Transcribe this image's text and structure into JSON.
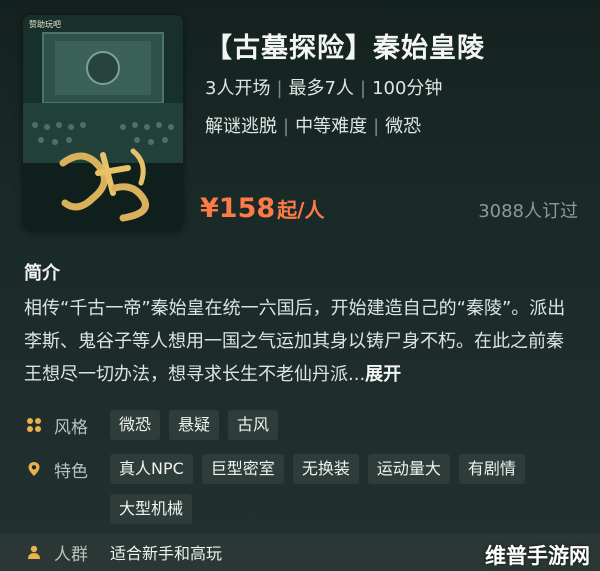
{
  "poster": {
    "brand": "赞助玩吧",
    "calligraphy": "秦始皇陵",
    "icon": "game-poster-image"
  },
  "title": "【古墓探险】秦始皇陵",
  "meta": {
    "players_start": "3人开场",
    "players_max": "最多7人",
    "duration": "100分钟",
    "genre": "解谜逃脱",
    "difficulty": "中等难度",
    "horror_level": "微恐"
  },
  "price": {
    "amount": "¥158",
    "unit": "起/人",
    "color": "#ff7a45"
  },
  "booked_count": "3088人订过",
  "intro": {
    "heading": "简介",
    "text": "相传“千古一帝”秦始皇在统一六国后，开始建造自己的“秦陵”。派出李斯、鬼谷子等人想用一国之气运加其身以铸尸身不朽。在此之前秦王想尽一切办法，想寻求长生不老仙丹派...",
    "expand_label": "展开"
  },
  "attributes": {
    "style": {
      "label": "风格",
      "icon": "grid-icon",
      "tags": [
        "微恐",
        "悬疑",
        "古风"
      ]
    },
    "feature": {
      "label": "特色",
      "icon": "location-pin-icon",
      "tags": [
        "真人NPC",
        "巨型密室",
        "无换装",
        "运动量大",
        "有剧情",
        "大型机械"
      ]
    },
    "crowd": {
      "label": "人群",
      "icon": "person-icon",
      "value": "适合新手和高玩"
    }
  },
  "watermark": "维普手游网"
}
